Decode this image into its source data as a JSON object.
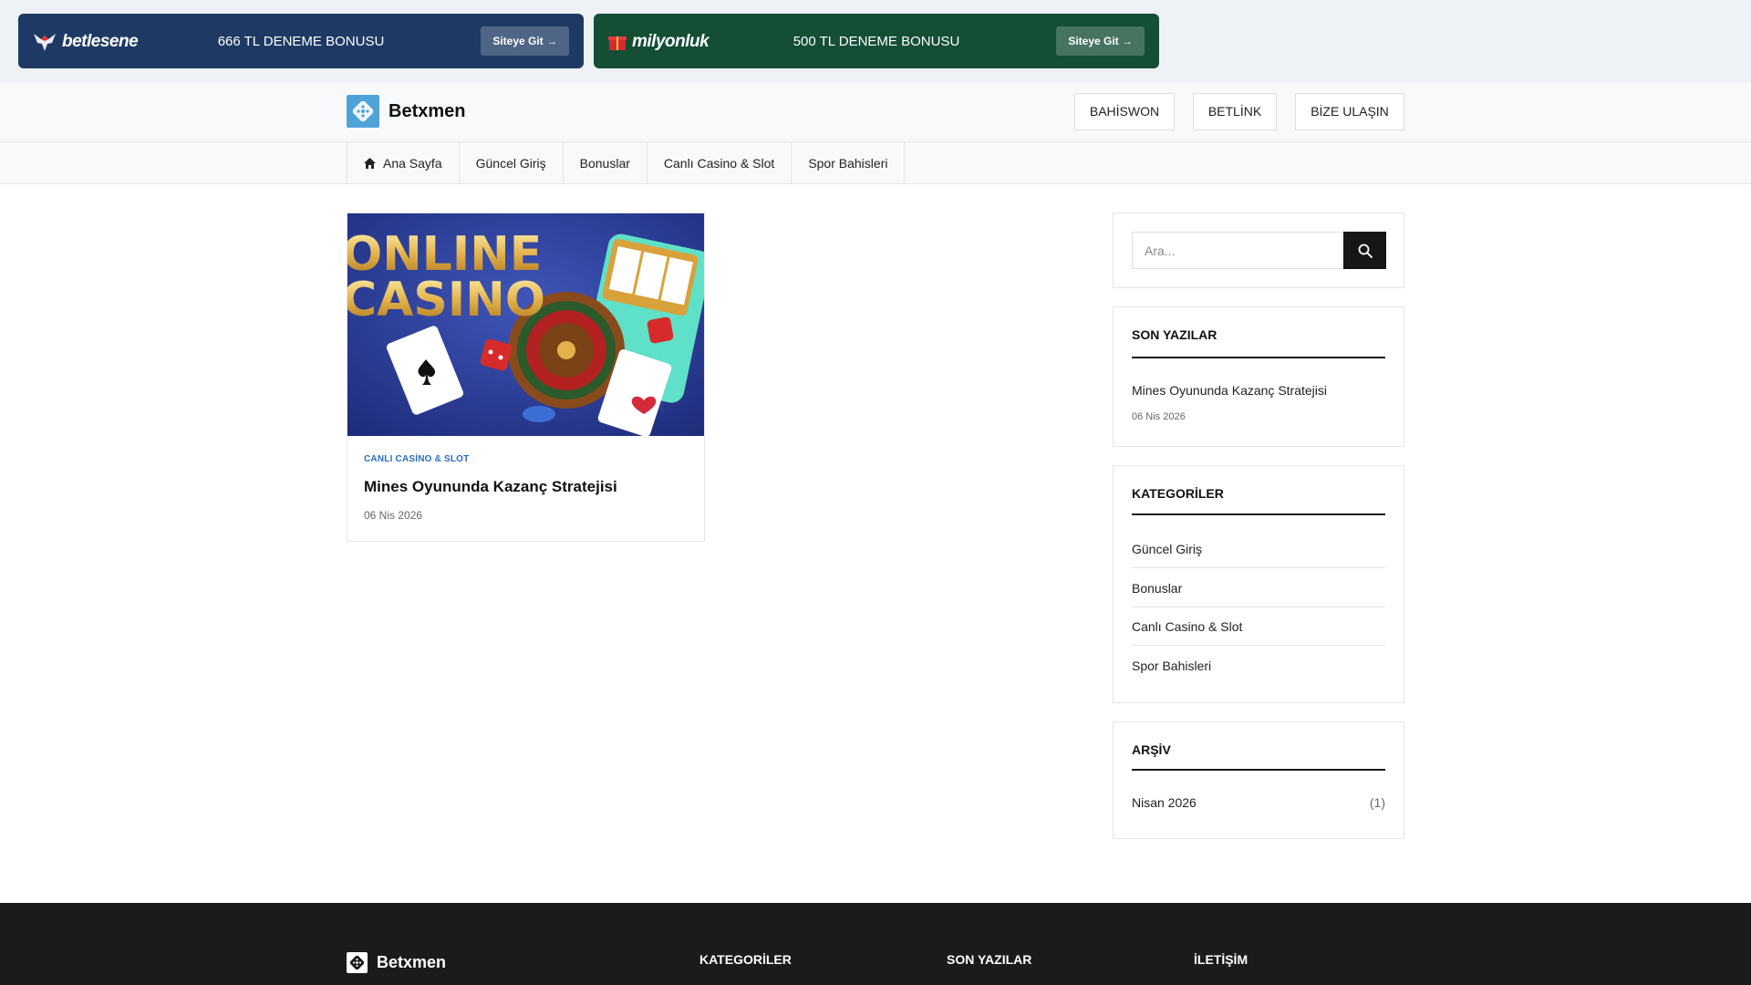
{
  "promos": [
    {
      "brand": "betlesene",
      "offer": "666 TL DENEME BONUSU",
      "cta": "Siteye Git →",
      "bg": "#1e3a64"
    },
    {
      "brand": "milyonluk",
      "offer": "500 TL DENEME BONUSU",
      "cta": "Siteye Git →",
      "bg": "#134e35"
    }
  ],
  "header": {
    "brand": "Betxmen",
    "buttons": [
      "BAHİSWON",
      "BETLİNK",
      "BİZE ULAŞIN"
    ]
  },
  "nav": {
    "items": [
      "Ana Sayfa",
      "Güncel Giriş",
      "Bonuslar",
      "Canlı Casino & Slot",
      "Spor Bahisleri"
    ],
    "home_icon": "home-icon"
  },
  "post": {
    "image_text": [
      "ONLINE",
      "CASINO"
    ],
    "category": "CANLI CASİNO & SLOT",
    "title": "Mines Oyununda Kazanç Stratejisi",
    "date": "06 Nis 2026"
  },
  "sidebar": {
    "search": {
      "placeholder": "Ara...",
      "icon": "search-icon"
    },
    "recent": {
      "title": "SON YAZILAR",
      "items": [
        {
          "title": "Mines Oyununda Kazanç Stratejisi",
          "date": "06 Nis 2026"
        }
      ]
    },
    "categories": {
      "title": "KATEGORİLER",
      "items": [
        "Güncel Giriş",
        "Bonuslar",
        "Canlı Casino & Slot",
        "Spor Bahisleri"
      ]
    },
    "archive": {
      "title": "ARŞİV",
      "items": [
        {
          "label": "Nisan 2026",
          "count": "(1)"
        }
      ]
    }
  },
  "footer": {
    "brand": "Betxmen",
    "headings": [
      "KATEGORİLER",
      "SON YAZILAR",
      "İLETİŞİM"
    ]
  },
  "colors": {
    "accent_link": "#2a6fbd",
    "dark": "#161616",
    "brand_icon": "#4fa3d9"
  }
}
